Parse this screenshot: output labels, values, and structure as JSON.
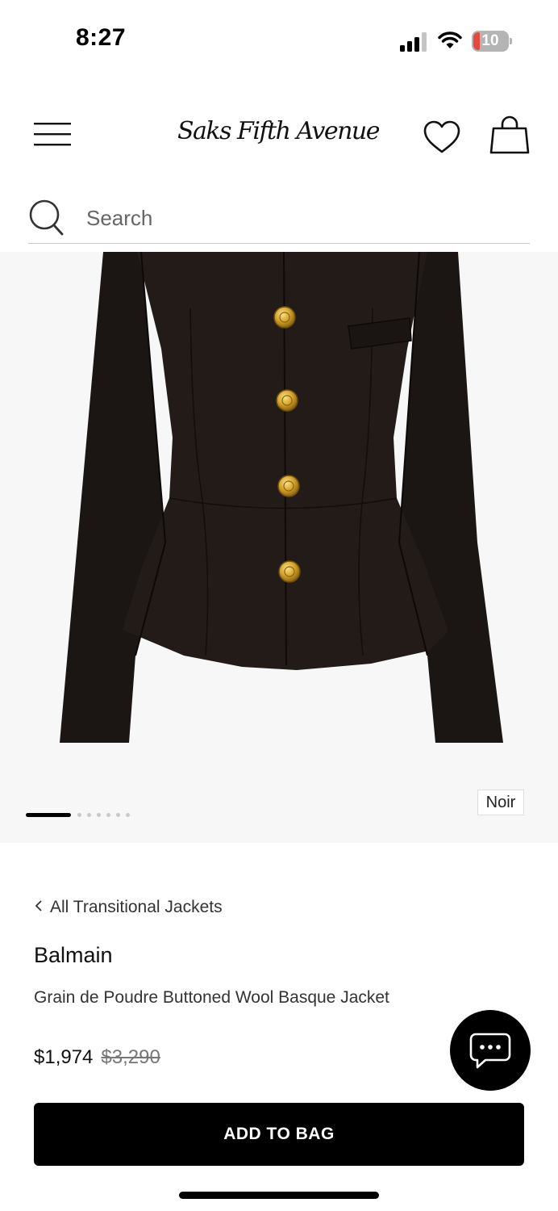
{
  "status_bar": {
    "time": "8:27",
    "battery_level": "10",
    "icons": [
      "signal-icon",
      "wifi-icon",
      "battery-icon"
    ]
  },
  "header": {
    "logo_text": "Saks Fifth Avenue",
    "icons": [
      "menu-icon",
      "heart-icon",
      "bag-icon"
    ]
  },
  "search": {
    "placeholder": "Search"
  },
  "gallery": {
    "color_label": "Noir",
    "image_count": 8,
    "active_index": 0
  },
  "product": {
    "breadcrumb": "All Transitional Jackets",
    "brand": "Balmain",
    "name": "Grain de Poudre Buttoned Wool Basque Jacket",
    "sale_price": "$1,974",
    "original_price": "$3,290"
  },
  "actions": {
    "add_to_bag_label": "ADD TO BAG",
    "chat_icon": "chat-bubble-icon"
  },
  "colors": {
    "primary": "#000000",
    "background": "#ffffff",
    "image_bg": "#f7f7f7",
    "battery_low": "#e3493f"
  }
}
